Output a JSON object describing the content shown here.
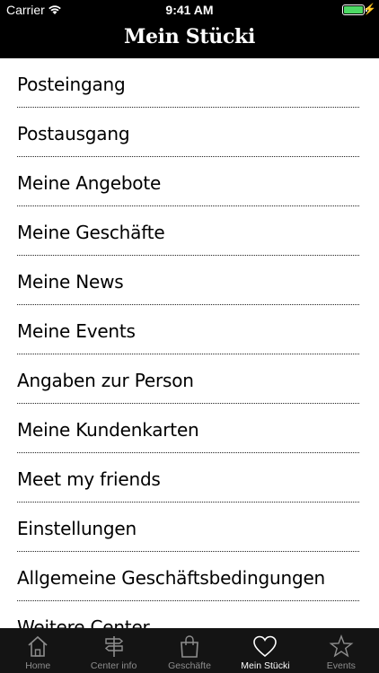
{
  "status_bar": {
    "carrier": "Carrier",
    "time": "9:41 AM"
  },
  "nav": {
    "title": "Mein Stücki"
  },
  "menu": [
    {
      "label": "Posteingang"
    },
    {
      "label": "Postausgang"
    },
    {
      "label": "Meine Angebote"
    },
    {
      "label": "Meine Geschäfte"
    },
    {
      "label": "Meine News"
    },
    {
      "label": "Meine Events"
    },
    {
      "label": "Angaben zur Person"
    },
    {
      "label": "Meine Kundenkarten"
    },
    {
      "label": "Meet my friends"
    },
    {
      "label": "Einstellungen"
    },
    {
      "label": "Allgemeine Geschäftsbedingungen"
    },
    {
      "label": "Weitere Center"
    }
  ],
  "tabs": [
    {
      "label": "Home",
      "icon": "home-icon"
    },
    {
      "label": "Center info",
      "icon": "signpost-icon"
    },
    {
      "label": "Geschäfte",
      "icon": "shopping-bag-icon"
    },
    {
      "label": "Mein Stücki",
      "icon": "heart-icon",
      "active": true
    },
    {
      "label": "Events",
      "icon": "star-icon"
    }
  ],
  "colors": {
    "battery": "#4cd964",
    "tab_active": "#ffffff",
    "tab_inactive": "#8e8e8e"
  }
}
